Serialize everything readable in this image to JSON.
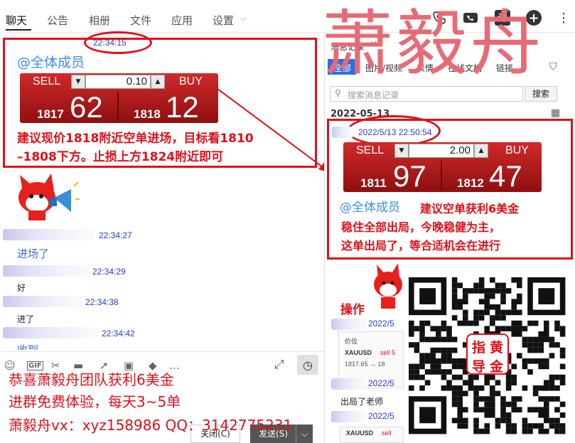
{
  "nav": {
    "tabs": [
      "聊天",
      "公告",
      "相册",
      "文件",
      "应用",
      "设置"
    ],
    "course_icon_label": "课"
  },
  "chat": {
    "msg1": {
      "time": "22:34:15",
      "at_all": "@全体成员",
      "trade": {
        "sell_label": "SELL",
        "buy_label": "BUY",
        "lot": "0.10",
        "sell_small": "1817",
        "sell_big": "62",
        "buy_small": "1818",
        "buy_big": "12"
      },
      "advice_line1": "建议现价1818附近空单进场，目标看1810",
      "advice_line2": "–1808下方。止损上方1824附近即可"
    },
    "msg2": {
      "time": "22:34:27",
      "text": "进场了"
    },
    "msg3": {
      "time": "22:34:29",
      "text": "好"
    },
    "msg4": {
      "time": "22:34:38",
      "text": "进了"
    },
    "msg5": {
      "time": "22:34:42",
      "text": "收到"
    }
  },
  "composer": {
    "gif": "GIF",
    "close_btn": "关闭(C)",
    "send_btn": "发送(S)"
  },
  "promo": {
    "line1": "恭喜萧毅舟团队获利6美金",
    "line2": "进群免费体验，每天3~5单",
    "line3": "萧毅舟vx：xyz158986  QQ：3142775231"
  },
  "right_panel": {
    "title": "消息记录",
    "tabs": [
      "全部",
      "图片/视频",
      "表情",
      "在线文档",
      "链接"
    ],
    "search_placeholder": "搜索消息记录",
    "search_btn": "搜索",
    "date": "2022-05-13",
    "msg": {
      "time": "2022/5/13 22:50:54",
      "trade": {
        "sell_label": "SELL",
        "buy_label": "BUY",
        "lot": "2.00",
        "sell_small": "1811",
        "sell_big": "97",
        "buy_small": "1812",
        "buy_big": "47"
      },
      "at_all": "@全体成员",
      "advice_line1": "建议空单获利6美金",
      "advice_line2": "稳住全部出局，今晚稳健为主，",
      "advice_line3": "这单出局了，等合适机会在进行"
    },
    "op_label": "操作",
    "date_frag1": "2022/5",
    "price_label": "价位",
    "symbol": "XAUUSD",
    "sell_frag": "sell 5",
    "price_frag": "1817.65 → 18",
    "date_frag2": "2022/5",
    "reply_text": "出局了老师",
    "date_frag3": "2022/5",
    "sell_frag2": "sell"
  },
  "watermark": "萧毅舟",
  "qr": {
    "seal_text": "黄金指导"
  },
  "colors": {
    "accent_red": "#e0101a",
    "link_blue": "#2a3bd0",
    "at_blue": "#3a8fe8"
  }
}
